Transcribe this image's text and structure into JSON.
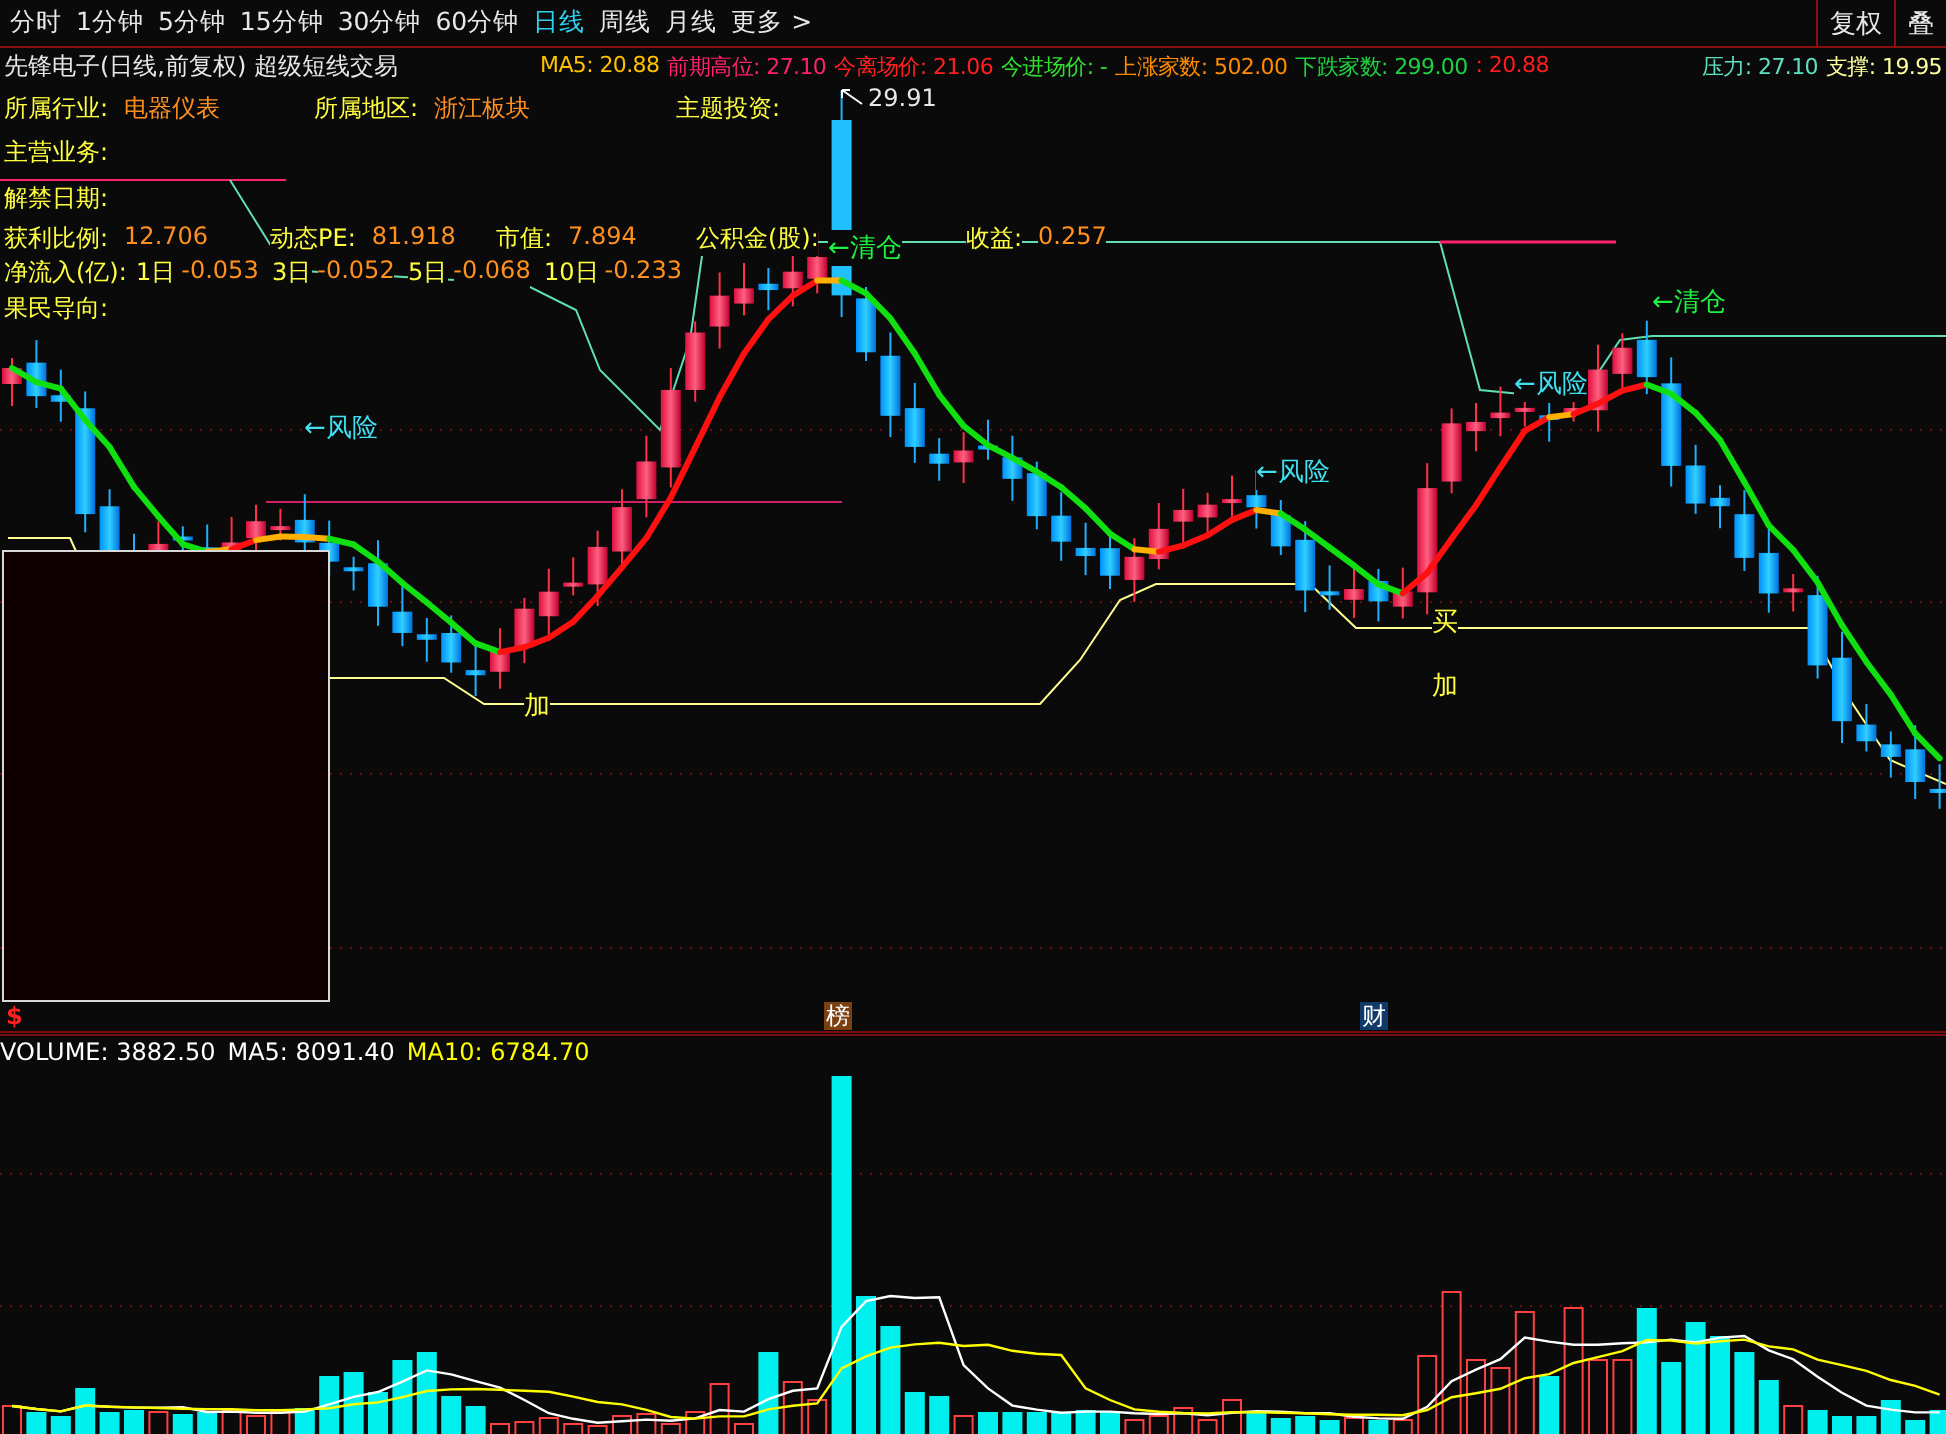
{
  "period_tabs": [
    {
      "label": "分时",
      "selected": false
    },
    {
      "label": "1分钟",
      "selected": false
    },
    {
      "label": "5分钟",
      "selected": false
    },
    {
      "label": "15分钟",
      "selected": false
    },
    {
      "label": "30分钟",
      "selected": false
    },
    {
      "label": "60分钟",
      "selected": false
    },
    {
      "label": "日线",
      "selected": true
    },
    {
      "label": "周线",
      "selected": false
    },
    {
      "label": "月线",
      "selected": false
    },
    {
      "label": "更多 >",
      "selected": false
    }
  ],
  "toolbar_buttons": [
    "复权",
    "叠"
  ],
  "chart_title": "先锋电子(日线,前复权) 超级短线交易",
  "indicators": [
    {
      "text": "MA5: 20.88",
      "color": "#ffc000"
    },
    {
      "text": "前期高位: 27.10",
      "color": "#ff2070"
    },
    {
      "text": "今离场价: 21.06",
      "color": "#ff2020"
    },
    {
      "text": "今进场价: -",
      "color": "#30e030"
    },
    {
      "text": "上涨家数: 502.00",
      "color": "#ff8c00"
    },
    {
      "text": "下跌家数: 299.00",
      "color": "#20d040"
    },
    {
      "text": ": 20.88",
      "color": "#ff1c1c"
    }
  ],
  "levels": [
    {
      "text": "压力: 27.10",
      "color": "#5fe0c0"
    },
    {
      "text": "支撑: 19.95",
      "color": "#ffffa0"
    }
  ],
  "stock_info": [
    [
      {
        "label": "所属行业:",
        "value": "电器仪表"
      },
      {
        "label": "所属地区:",
        "value": "浙江板块"
      },
      {
        "label": "主题投资:"
      }
    ],
    [
      {
        "label": "主营业务:"
      }
    ],
    [
      {
        "label": "解禁日期:"
      }
    ],
    [
      {
        "label": "获利比例:",
        "value": "12.706"
      },
      {
        "label": "动态PE:",
        "value": "81.918"
      },
      {
        "label": "市值:",
        "value": "7.894"
      },
      {
        "label": "公积金(股):"
      },
      {
        "label": "收益:",
        "value": "0.257"
      }
    ]
  ],
  "net_inflow": {
    "label": "净流入(亿):",
    "periods": [
      {
        "label": "1日",
        "value": "-0.053"
      },
      {
        "label": "3日",
        "value": "-0.052"
      },
      {
        "label": "5日",
        "value": "-0.068"
      },
      {
        "label": "10日",
        "value": "-0.233"
      }
    ]
  },
  "guidance": {
    "label": "果民导向:"
  },
  "peak_label": "29.91",
  "annotations": [
    {
      "text": "←风险",
      "kind": "risk"
    },
    {
      "text": "←风险",
      "kind": "risk"
    },
    {
      "text": "←风险",
      "kind": "risk"
    },
    {
      "text": "←清仓",
      "kind": "exit"
    },
    {
      "text": "←清仓",
      "kind": "exit"
    },
    {
      "text": "买",
      "kind": "signal"
    },
    {
      "text": "加",
      "kind": "signal"
    },
    {
      "text": "加",
      "kind": "signal"
    }
  ],
  "event_badges": [
    {
      "text": "$",
      "kind": "dollar"
    },
    {
      "text": "榜",
      "kind": "list"
    },
    {
      "text": "财",
      "kind": "finance"
    }
  ],
  "volume_readings": [
    {
      "text": "VOLUME: 3882.50",
      "color": "#ffffff"
    },
    {
      "text": "MA5: 8091.40",
      "color": "#ffffff"
    },
    {
      "text": "MA10: 6784.70",
      "color": "#ffff00"
    }
  ]
}
